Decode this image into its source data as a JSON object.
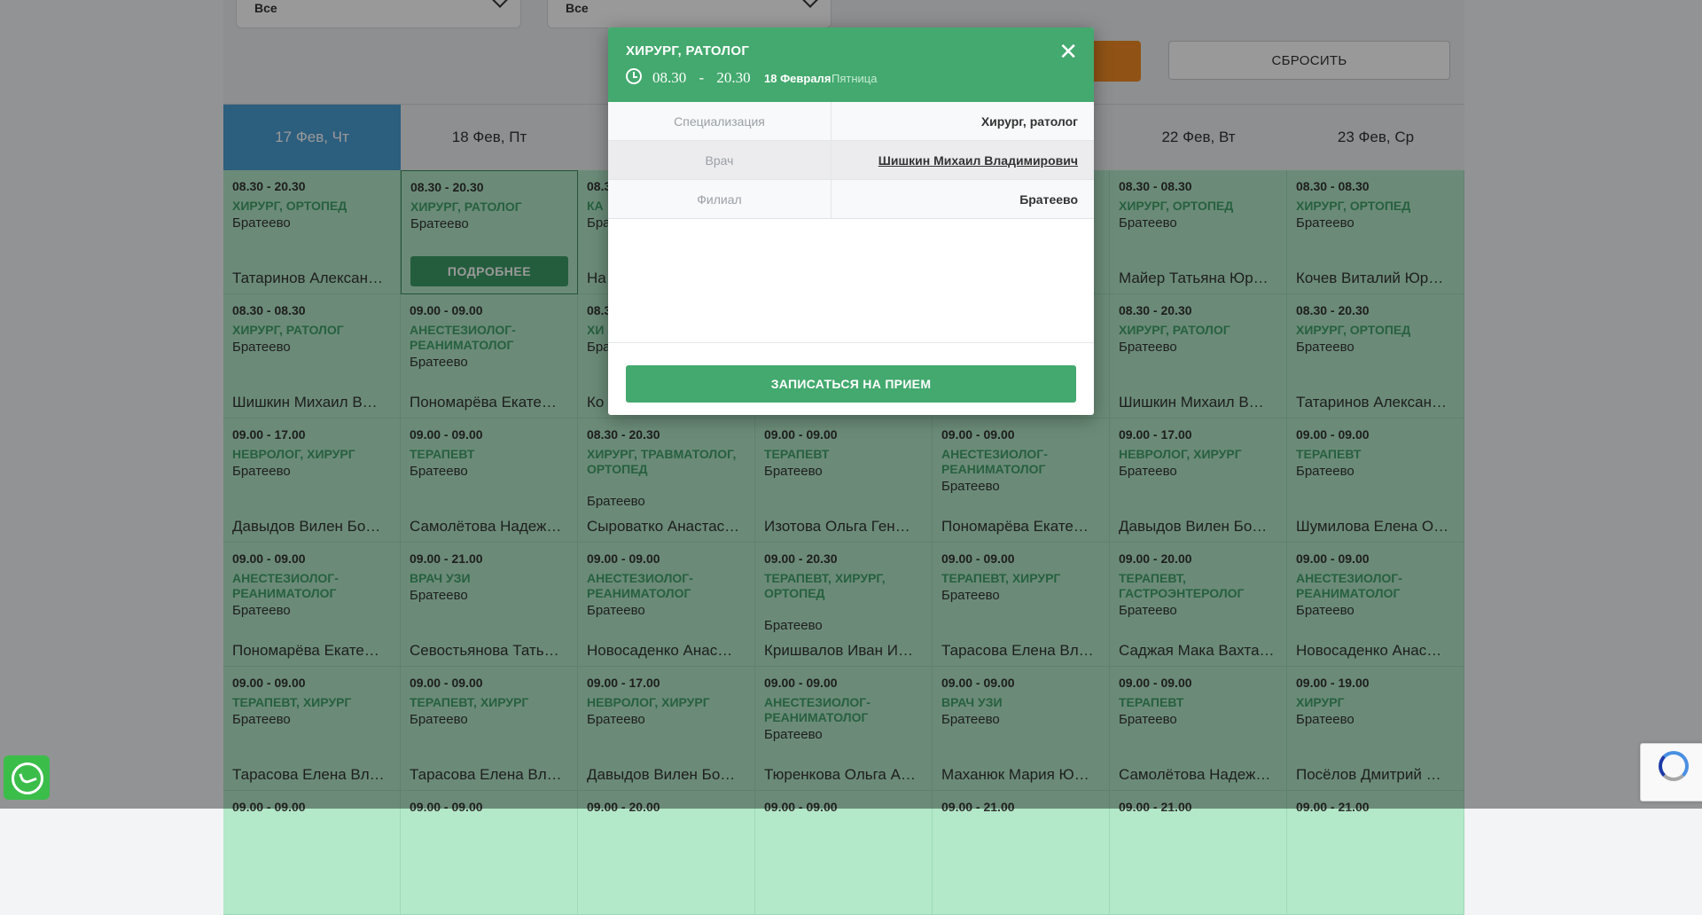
{
  "filters": [
    {
      "value": "Все"
    },
    {
      "value": "Все"
    }
  ],
  "reset_label": "СБРОСИТЬ",
  "days": [
    {
      "label": "17 Фев, Чт",
      "active": true
    },
    {
      "label": "18 Фев, Пт",
      "active": false
    },
    {
      "label": "",
      "active": false
    },
    {
      "label": "",
      "active": false
    },
    {
      "label": "",
      "active": false
    },
    {
      "label": "22 Фев, Вт",
      "active": false
    },
    {
      "label": "23 Фев, Ср",
      "active": false
    }
  ],
  "rows": [
    [
      {
        "time": "08.30 - 20.30",
        "spec": "ХИРУРГ, ОРТОПЕД",
        "branch": "Братеево",
        "doctor": "Татаринов Алексан…"
      },
      {
        "time": "08.30 - 20.30",
        "spec": "ХИРУРГ, РАТОЛОГ",
        "branch": "Братеево",
        "doctor": "",
        "selected": true
      },
      {
        "time": "08.3",
        "spec": "КА",
        "branch": "Бра",
        "doctor": "На"
      },
      {
        "time": "",
        "spec": "",
        "branch": "",
        "doctor": ""
      },
      {
        "time": "",
        "spec": "",
        "branch": "",
        "doctor": ""
      },
      {
        "time": "08.30 - 08.30",
        "spec": "ХИРУРГ, ОРТОПЕД",
        "branch": "Братеево",
        "doctor": "Майер Татьяна Юр…"
      },
      {
        "time": "08.30 - 08.30",
        "spec": "ХИРУРГ, ОРТОПЕД",
        "branch": "Братеево",
        "doctor": "Кочев Виталий Юр…"
      }
    ],
    [
      {
        "time": "08.30 - 08.30",
        "spec": "ХИРУРГ, РАТОЛОГ",
        "branch": "Братеево",
        "doctor": "Шишкин Михаил В…"
      },
      {
        "time": "09.00 - 09.00",
        "spec": "АНЕСТЕЗИОЛОГ-РЕАНИМАТОЛОГ",
        "branch": "Братеево",
        "doctor": "Пономарёва Екате…"
      },
      {
        "time": "08.3",
        "spec": "ХИ",
        "branch": "Бра",
        "doctor": "Ко"
      },
      {
        "time": "",
        "spec": "",
        "branch": "",
        "doctor": ""
      },
      {
        "time": "",
        "spec": "",
        "branch": "",
        "doctor": ""
      },
      {
        "time": "08.30 - 20.30",
        "spec": "ХИРУРГ, РАТОЛОГ",
        "branch": "Братеево",
        "doctor": "Шишкин Михаил В…"
      },
      {
        "time": "08.30 - 20.30",
        "spec": "ХИРУРГ, ОРТОПЕД",
        "branch": "Братеево",
        "doctor": "Татаринов Алексан…"
      }
    ],
    [
      {
        "time": "09.00 - 17.00",
        "spec": "НЕВРОЛОГ, ХИРУРГ",
        "branch": "Братеево",
        "doctor": "Давыдов Вилен Бо…"
      },
      {
        "time": "09.00 - 09.00",
        "spec": "ТЕРАПЕВТ",
        "branch": "Братеево",
        "doctor": "Самолётова Надеж…"
      },
      {
        "time": "08.30 - 20.30",
        "spec": "ХИРУРГ, ТРАВМАТОЛОГ, ОРТОПЕД",
        "branch": "Братеево",
        "doctor": "Сыроватко Анастас…"
      },
      {
        "time": "09.00 - 09.00",
        "spec": "ТЕРАПЕВТ",
        "branch": "Братеево",
        "doctor": "Изотова Ольга Ген…"
      },
      {
        "time": "09.00 - 09.00",
        "spec": "АНЕСТЕЗИОЛОГ-РЕАНИМАТОЛОГ",
        "branch": "Братеево",
        "doctor": "Пономарёва Екате…"
      },
      {
        "time": "09.00 - 17.00",
        "spec": "НЕВРОЛОГ, ХИРУРГ",
        "branch": "Братеево",
        "doctor": "Давыдов Вилен Бо…"
      },
      {
        "time": "09.00 - 09.00",
        "spec": "ТЕРАПЕВТ",
        "branch": "Братеево",
        "doctor": "Шумилова Елена О…"
      }
    ],
    [
      {
        "time": "09.00 - 09.00",
        "spec": "АНЕСТЕЗИОЛОГ-РЕАНИМАТОЛОГ",
        "branch": "Братеево",
        "doctor": "Пономарёва Екате…"
      },
      {
        "time": "09.00 - 21.00",
        "spec": "ВРАЧ УЗИ",
        "branch": "Братеево",
        "doctor": "Севостьянова Тать…"
      },
      {
        "time": "09.00 - 09.00",
        "spec": "АНЕСТЕЗИОЛОГ-РЕАНИМАТОЛОГ",
        "branch": "Братеево",
        "doctor": "Новосаденко Анас…"
      },
      {
        "time": "09.00 - 20.30",
        "spec": "ТЕРАПЕВТ, ХИРУРГ, ОРТОПЕД",
        "branch": "Братеево",
        "doctor": "Кришвалов Иван И…"
      },
      {
        "time": "09.00 - 09.00",
        "spec": "ТЕРАПЕВТ, ХИРУРГ",
        "branch": "Братеево",
        "doctor": "Тарасова Елена Вл…"
      },
      {
        "time": "09.00 - 20.00",
        "spec": "ТЕРАПЕВТ, ГАСТРОЭНТЕРОЛОГ",
        "branch": "Братеево",
        "doctor": "Саджая Мака Вахта…"
      },
      {
        "time": "09.00 - 09.00",
        "spec": "АНЕСТЕЗИОЛОГ-РЕАНИМАТОЛОГ",
        "branch": "Братеево",
        "doctor": "Новосаденко Анас…"
      }
    ],
    [
      {
        "time": "09.00 - 09.00",
        "spec": "ТЕРАПЕВТ, ХИРУРГ",
        "branch": "Братеево",
        "doctor": "Тарасова Елена Вл…"
      },
      {
        "time": "09.00 - 09.00",
        "spec": "ТЕРАПЕВТ, ХИРУРГ",
        "branch": "Братеево",
        "doctor": "Тарасова Елена Вл…"
      },
      {
        "time": "09.00 - 17.00",
        "spec": "НЕВРОЛОГ, ХИРУРГ",
        "branch": "Братеево",
        "doctor": "Давыдов Вилен Бо…"
      },
      {
        "time": "09.00 - 09.00",
        "spec": "АНЕСТЕЗИОЛОГ-РЕАНИМАТОЛОГ",
        "branch": "Братеево",
        "doctor": "Тюренкова Ольга А…"
      },
      {
        "time": "09.00 - 09.00",
        "spec": "ВРАЧ УЗИ",
        "branch": "Братеево",
        "doctor": "Маханюк Мария Ю…"
      },
      {
        "time": "09.00 - 09.00",
        "spec": "ТЕРАПЕВТ",
        "branch": "Братеево",
        "doctor": "Самолётова Надеж…"
      },
      {
        "time": "09.00 - 19.00",
        "spec": "ХИРУРГ",
        "branch": "Братеево",
        "doctor": "Посёлов Дмитрий …"
      }
    ],
    [
      {
        "time": "09.00 - 09.00",
        "spec": "",
        "branch": "",
        "doctor": ""
      },
      {
        "time": "09.00 - 09.00",
        "spec": "",
        "branch": "",
        "doctor": ""
      },
      {
        "time": "09.00 - 20.00",
        "spec": "",
        "branch": "",
        "doctor": ""
      },
      {
        "time": "09.00 - 09.00",
        "spec": "",
        "branch": "",
        "doctor": ""
      },
      {
        "time": "09.00 - 21.00",
        "spec": "",
        "branch": "",
        "doctor": ""
      },
      {
        "time": "09.00 - 21.00",
        "spec": "",
        "branch": "",
        "doctor": ""
      },
      {
        "time": "09.00 - 21.00",
        "spec": "",
        "branch": "",
        "doctor": ""
      }
    ]
  ],
  "more_label": "ПОДРОБНЕЕ",
  "modal": {
    "title": "ХИРУРГ, РАТОЛОГ",
    "time_from": "08.30",
    "time_sep": "-",
    "time_to": "20.30",
    "date": "18 Февраля",
    "weekday": "Пятница",
    "rows": [
      {
        "label": "Специализация",
        "value": "Хирург, ратолог"
      },
      {
        "label": "Врач",
        "value": "Шишкин Михаил Владимирович"
      },
      {
        "label": "Филиал",
        "value": "Братеево"
      }
    ],
    "close_glyph": "✕",
    "book_label": "ЗАПИСАТЬСЯ НА ПРИЕМ"
  },
  "colors": {
    "accent_green": "#43a96e",
    "active_day": "#4a9dd3",
    "orange": "#f08a24"
  },
  "icons": {
    "whatsapp": "whatsapp-icon",
    "clock": "clock-icon",
    "close": "close-icon"
  }
}
